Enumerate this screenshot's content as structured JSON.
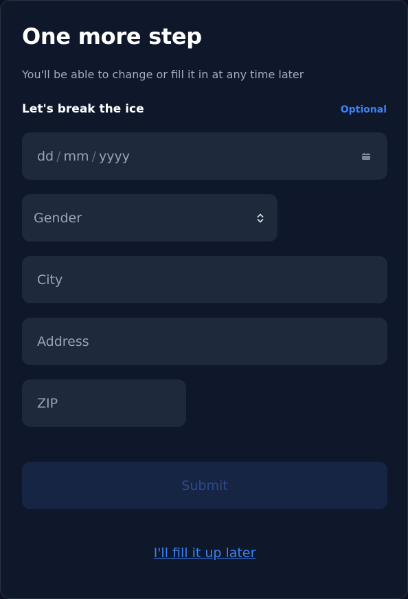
{
  "header": {
    "title": "One more step",
    "subtitle": "You'll be able to change or fill it in at any time later"
  },
  "section": {
    "label": "Let's break the ice",
    "optional_label": "Optional"
  },
  "form": {
    "date": {
      "day": "dd",
      "month": "mm",
      "year": "yyyy",
      "separator": "/",
      "icon": "calendar-icon"
    },
    "gender": {
      "selected": "Gender",
      "icon": "chevron-up-down-icon"
    },
    "city": {
      "placeholder": "City"
    },
    "address": {
      "placeholder": "Address"
    },
    "zip": {
      "placeholder": "ZIP"
    },
    "submit_label": "Submit",
    "later_label": "I'll fill it up later"
  },
  "colors": {
    "background": "#0f172a",
    "field": "#1e293b",
    "accent": "#3b82f6",
    "submit_disabled": "#172544"
  }
}
